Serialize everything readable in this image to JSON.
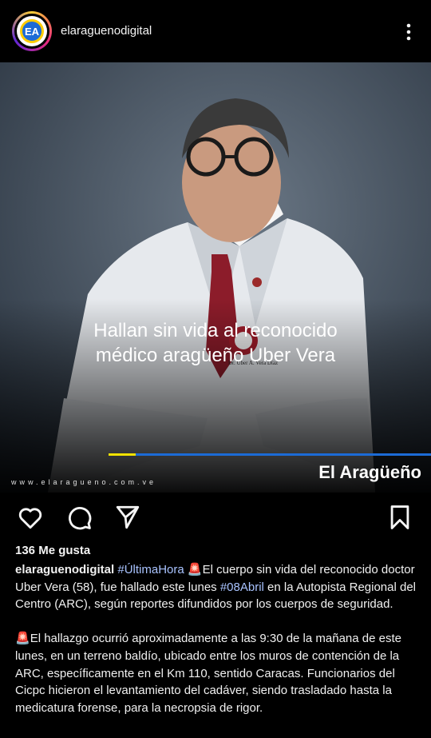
{
  "header": {
    "username": "elaraguenodigital",
    "avatar_text": "EA",
    "more_icon": "more-vertical-icon"
  },
  "post": {
    "headline_line1": "Hallan sin vida al reconocido",
    "headline_line2": "médico aragüeño Uber Vera",
    "website": "www.elaragueno.com.ve",
    "brand": "El Aragüeño",
    "coat_text": "Dr. Uber A. Vera Díaz"
  },
  "actions": {
    "like_icon": "heart-icon",
    "comment_icon": "comment-icon",
    "share_icon": "send-icon",
    "save_icon": "bookmark-icon"
  },
  "likes": "136 Me gusta",
  "caption": {
    "username": "elaraguenodigital",
    "tag1": "#ÚltimaHora",
    "siren": "🚨",
    "text1": "El cuerpo sin vida del reconocido doctor Uber Vera (58), fue hallado este lunes ",
    "tag2": "#08Abril",
    "text2": " en la Autopista Regional del Centro (ARC), según reportes difundidos por los cuerpos de seguridad.",
    "para2": "El hallazgo ocurrió aproximadamente a las 9:30 de la mañana de este lunes, en un terreno baldío, ubicado entre los muros de contención de la ARC, específicamente en el Km 110, sentido Caracas. Funcionarios del Cicpc hicieron el levantamiento del cadáver, siendo trasladado hasta la medicatura forense, para la necropsia de rigor."
  },
  "colors": {
    "accent_yellow": "#f2e200",
    "accent_blue": "#1c6bd6",
    "hashtag": "#a9c3ff"
  }
}
